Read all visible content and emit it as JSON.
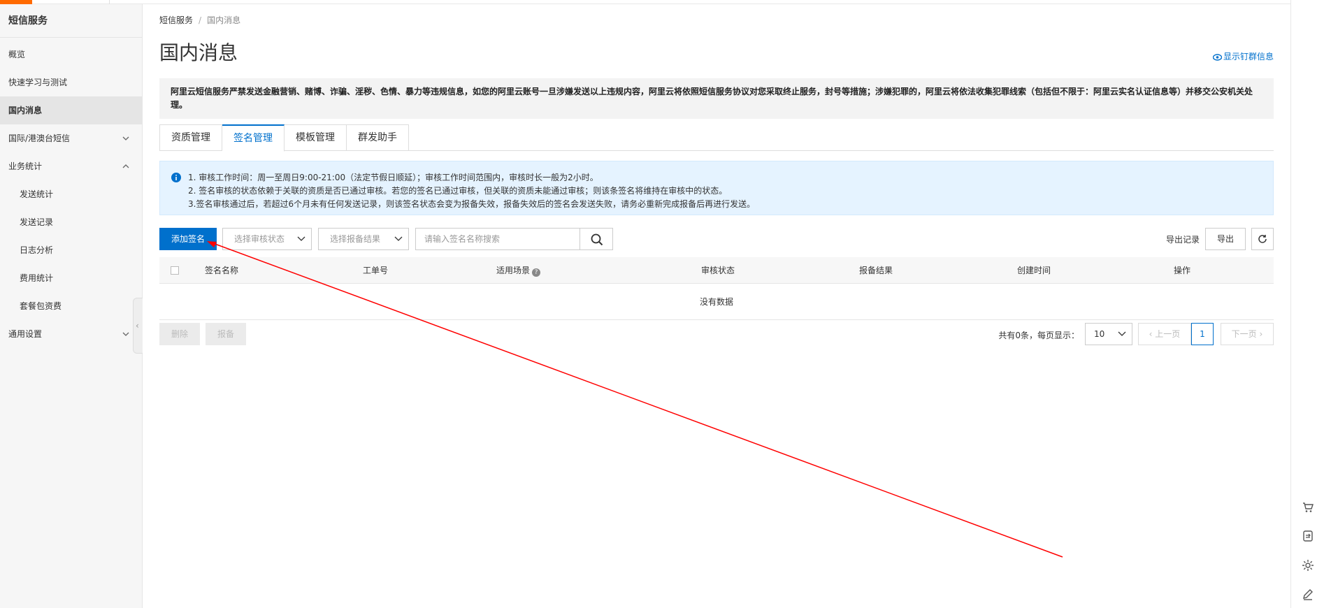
{
  "sidebar": {
    "title": "短信服务",
    "items": [
      {
        "label": "概览"
      },
      {
        "label": "快速学习与测试"
      },
      {
        "label": "国内消息"
      },
      {
        "label": "国际/港澳台短信"
      },
      {
        "label": "业务统计"
      },
      {
        "label": "发送统计"
      },
      {
        "label": "发送记录"
      },
      {
        "label": "日志分析"
      },
      {
        "label": "费用统计"
      },
      {
        "label": "套餐包资费"
      },
      {
        "label": "通用设置"
      }
    ]
  },
  "breadcrumb": {
    "root": "短信服务",
    "separator": "/",
    "current": "国内消息"
  },
  "page": {
    "title": "国内消息",
    "pin_link": "显示钉群信息",
    "warning": "阿里云短信服务严禁发送金融营销、赌博、诈骗、淫秽、色情、暴力等违规信息，如您的阿里云账号一旦涉嫌发送以上违规内容，阿里云将依照短信服务协议对您采取终止服务，封号等措施；涉嫌犯罪的，阿里云将依法收集犯罪线索（包括但不限于：阿里云实名认证信息等）并移交公安机关处理。"
  },
  "tabs": [
    {
      "label": "资质管理"
    },
    {
      "label": "签名管理",
      "active": true
    },
    {
      "label": "模板管理"
    },
    {
      "label": "群发助手"
    }
  ],
  "notice": {
    "lines": [
      "1. 审核工作时间：周一至周日9:00-21:00（法定节假日顺延）；审核工作时间范围内，审核时长一般为2小时。",
      "2. 签名审核的状态依赖于关联的资质是否已通过审核。若您的签名已通过审核，但关联的资质未能通过审核；则该条签名将维持在审核中的状态。",
      "3.签名审核通过后，若超过6个月未有任何发送记录，则该签名状态会变为报备失效，报备失效后的签名会发送失败，请务必重新完成报备后再进行发送。"
    ]
  },
  "toolbar": {
    "add_label": "添加签名",
    "status_select": "选择审核状态",
    "filing_select": "选择报备结果",
    "search_placeholder": "请输入签名名称搜索",
    "export_log": "导出记录",
    "export": "导出"
  },
  "table": {
    "columns": [
      "签名名称",
      "工单号",
      "适用场景",
      "审核状态",
      "报备结果",
      "创建时间",
      "操作"
    ],
    "empty_text": "没有数据"
  },
  "footer": {
    "delete_label": "删除",
    "file_label": "报备",
    "total_text": "共有0条，每页显示：",
    "page_size": "10",
    "prev": "上一页",
    "current_page": "1",
    "next": "下一页"
  },
  "colors": {
    "primary": "#0070cc",
    "brand": "#ff6a00",
    "annotation_arrow": "#ff0000"
  },
  "icons": [
    "info-icon",
    "search-icon",
    "refresh-icon",
    "chevron-down-icon",
    "eye-icon",
    "cart-icon",
    "gear-icon",
    "edit-icon",
    "help-icon"
  ]
}
